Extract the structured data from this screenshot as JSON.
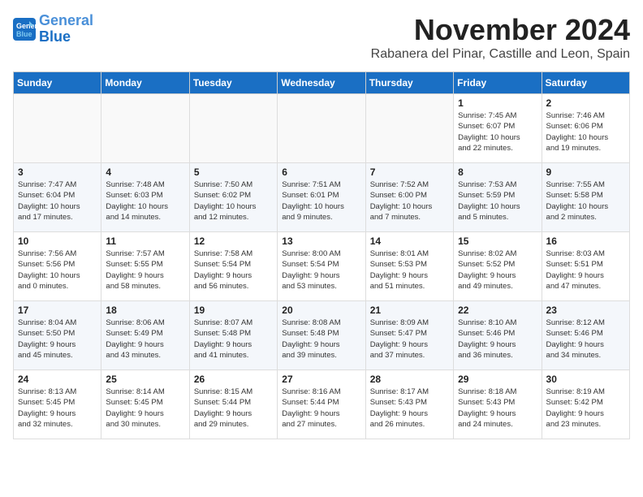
{
  "header": {
    "logo_line1": "General",
    "logo_line2": "Blue",
    "month_title": "November 2024",
    "location": "Rabanera del Pinar, Castille and Leon, Spain"
  },
  "weekdays": [
    "Sunday",
    "Monday",
    "Tuesday",
    "Wednesday",
    "Thursday",
    "Friday",
    "Saturday"
  ],
  "weeks": [
    [
      {
        "day": "",
        "info": ""
      },
      {
        "day": "",
        "info": ""
      },
      {
        "day": "",
        "info": ""
      },
      {
        "day": "",
        "info": ""
      },
      {
        "day": "",
        "info": ""
      },
      {
        "day": "1",
        "info": "Sunrise: 7:45 AM\nSunset: 6:07 PM\nDaylight: 10 hours\nand 22 minutes."
      },
      {
        "day": "2",
        "info": "Sunrise: 7:46 AM\nSunset: 6:06 PM\nDaylight: 10 hours\nand 19 minutes."
      }
    ],
    [
      {
        "day": "3",
        "info": "Sunrise: 7:47 AM\nSunset: 6:04 PM\nDaylight: 10 hours\nand 17 minutes."
      },
      {
        "day": "4",
        "info": "Sunrise: 7:48 AM\nSunset: 6:03 PM\nDaylight: 10 hours\nand 14 minutes."
      },
      {
        "day": "5",
        "info": "Sunrise: 7:50 AM\nSunset: 6:02 PM\nDaylight: 10 hours\nand 12 minutes."
      },
      {
        "day": "6",
        "info": "Sunrise: 7:51 AM\nSunset: 6:01 PM\nDaylight: 10 hours\nand 9 minutes."
      },
      {
        "day": "7",
        "info": "Sunrise: 7:52 AM\nSunset: 6:00 PM\nDaylight: 10 hours\nand 7 minutes."
      },
      {
        "day": "8",
        "info": "Sunrise: 7:53 AM\nSunset: 5:59 PM\nDaylight: 10 hours\nand 5 minutes."
      },
      {
        "day": "9",
        "info": "Sunrise: 7:55 AM\nSunset: 5:58 PM\nDaylight: 10 hours\nand 2 minutes."
      }
    ],
    [
      {
        "day": "10",
        "info": "Sunrise: 7:56 AM\nSunset: 5:56 PM\nDaylight: 10 hours\nand 0 minutes."
      },
      {
        "day": "11",
        "info": "Sunrise: 7:57 AM\nSunset: 5:55 PM\nDaylight: 9 hours\nand 58 minutes."
      },
      {
        "day": "12",
        "info": "Sunrise: 7:58 AM\nSunset: 5:54 PM\nDaylight: 9 hours\nand 56 minutes."
      },
      {
        "day": "13",
        "info": "Sunrise: 8:00 AM\nSunset: 5:54 PM\nDaylight: 9 hours\nand 53 minutes."
      },
      {
        "day": "14",
        "info": "Sunrise: 8:01 AM\nSunset: 5:53 PM\nDaylight: 9 hours\nand 51 minutes."
      },
      {
        "day": "15",
        "info": "Sunrise: 8:02 AM\nSunset: 5:52 PM\nDaylight: 9 hours\nand 49 minutes."
      },
      {
        "day": "16",
        "info": "Sunrise: 8:03 AM\nSunset: 5:51 PM\nDaylight: 9 hours\nand 47 minutes."
      }
    ],
    [
      {
        "day": "17",
        "info": "Sunrise: 8:04 AM\nSunset: 5:50 PM\nDaylight: 9 hours\nand 45 minutes."
      },
      {
        "day": "18",
        "info": "Sunrise: 8:06 AM\nSunset: 5:49 PM\nDaylight: 9 hours\nand 43 minutes."
      },
      {
        "day": "19",
        "info": "Sunrise: 8:07 AM\nSunset: 5:48 PM\nDaylight: 9 hours\nand 41 minutes."
      },
      {
        "day": "20",
        "info": "Sunrise: 8:08 AM\nSunset: 5:48 PM\nDaylight: 9 hours\nand 39 minutes."
      },
      {
        "day": "21",
        "info": "Sunrise: 8:09 AM\nSunset: 5:47 PM\nDaylight: 9 hours\nand 37 minutes."
      },
      {
        "day": "22",
        "info": "Sunrise: 8:10 AM\nSunset: 5:46 PM\nDaylight: 9 hours\nand 36 minutes."
      },
      {
        "day": "23",
        "info": "Sunrise: 8:12 AM\nSunset: 5:46 PM\nDaylight: 9 hours\nand 34 minutes."
      }
    ],
    [
      {
        "day": "24",
        "info": "Sunrise: 8:13 AM\nSunset: 5:45 PM\nDaylight: 9 hours\nand 32 minutes."
      },
      {
        "day": "25",
        "info": "Sunrise: 8:14 AM\nSunset: 5:45 PM\nDaylight: 9 hours\nand 30 minutes."
      },
      {
        "day": "26",
        "info": "Sunrise: 8:15 AM\nSunset: 5:44 PM\nDaylight: 9 hours\nand 29 minutes."
      },
      {
        "day": "27",
        "info": "Sunrise: 8:16 AM\nSunset: 5:44 PM\nDaylight: 9 hours\nand 27 minutes."
      },
      {
        "day": "28",
        "info": "Sunrise: 8:17 AM\nSunset: 5:43 PM\nDaylight: 9 hours\nand 26 minutes."
      },
      {
        "day": "29",
        "info": "Sunrise: 8:18 AM\nSunset: 5:43 PM\nDaylight: 9 hours\nand 24 minutes."
      },
      {
        "day": "30",
        "info": "Sunrise: 8:19 AM\nSunset: 5:42 PM\nDaylight: 9 hours\nand 23 minutes."
      }
    ]
  ]
}
